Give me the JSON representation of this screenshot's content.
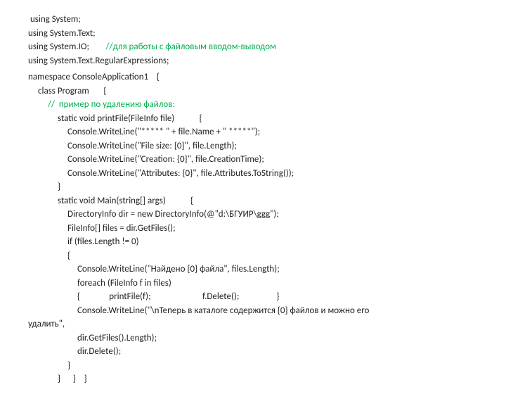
{
  "lines": {
    "l0": " using System;",
    "l1": "using System.Text;",
    "l2a": "using System.IO;",
    "l2b": "        //для работы с файловым вводом-выводом",
    "l3": "using System.Text.RegularExpressions;",
    "l5": "namespace ConsoleApplication1    {",
    "l6": "class Program       {",
    "l7": "//  пример по удалению файлов:",
    "l8": "static void printFile(FileInfo file)            {",
    "l9": "Console.WriteLine(\"***** \" + file.Name + \" *****\");",
    "l10": "Console.WriteLine(\"File size: {0}\", file.Length);",
    "l11": "Console.WriteLine(\"Creation: {0}\", file.CreationTime);",
    "l12": "Console.WriteLine(\"Attributes: {0}\", file.Attributes.ToString());",
    "l13": "}",
    "l14": "static void Main(string[] args)            {",
    "l15": "DirectoryInfo dir = new DirectoryInfo(@\"d:\\БГУИР\\ggg\");",
    "l16": "FileInfo[] files = dir.GetFiles();",
    "l17": "if (files.Length != 0)",
    "l18": "{",
    "l19": "Console.WriteLine(\"Найдено {0} файла\", files.Length);",
    "l20": "foreach (FileInfo f in files)",
    "l21": "{              printFile(f);                         f.Delete();                  }",
    "l22a": "Console.WriteLine(\"\\nТеперь в каталоге содержится {0} файлов и можно его",
    "l22b": "удалить\",",
    "l23": "dir.GetFiles().Length);",
    "l24": "dir.Delete();",
    "l25": "}",
    "l26": "}      }    }"
  }
}
